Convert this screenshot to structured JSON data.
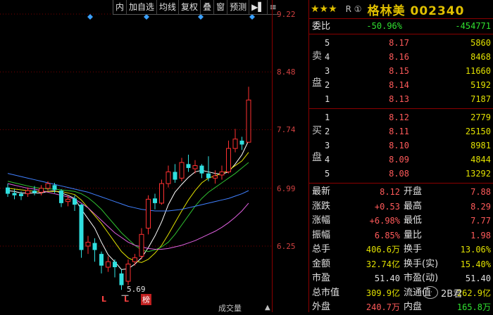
{
  "toolbar": {
    "items": [
      "内",
      "加自选",
      "均线",
      "复权",
      "叠",
      "窗",
      "预测"
    ],
    "expand_icon": "expand-icon",
    "menu_icon": "menu-icon"
  },
  "price_axis": [
    "9.22",
    "8.48",
    "7.74",
    "6.99",
    "6.25"
  ],
  "low_marker": {
    "label": "5.69",
    "value": 5.69
  },
  "bottom_badges": [
    "L",
    "L",
    "榜"
  ],
  "bottom_text": "成交量",
  "chart_data": {
    "type": "candlestick",
    "title": "",
    "ylim": [
      5.6,
      9.3
    ],
    "yticks": [
      9.22,
      8.48,
      7.74,
      6.99,
      6.25
    ],
    "candles": [
      {
        "o": 7.0,
        "c": 6.92,
        "h": 7.05,
        "l": 6.88
      },
      {
        "o": 6.93,
        "c": 6.9,
        "h": 6.98,
        "l": 6.85
      },
      {
        "o": 6.92,
        "c": 6.89,
        "h": 6.95,
        "l": 6.84
      },
      {
        "o": 6.92,
        "c": 6.96,
        "h": 7.0,
        "l": 6.88
      },
      {
        "o": 6.96,
        "c": 6.93,
        "h": 7.02,
        "l": 6.9
      },
      {
        "o": 6.94,
        "c": 6.99,
        "h": 7.03,
        "l": 6.9
      },
      {
        "o": 6.99,
        "c": 7.05,
        "h": 7.08,
        "l": 6.96
      },
      {
        "o": 7.03,
        "c": 6.97,
        "h": 7.06,
        "l": 6.93
      },
      {
        "o": 6.96,
        "c": 6.8,
        "h": 6.98,
        "l": 6.75
      },
      {
        "o": 6.82,
        "c": 6.85,
        "h": 6.9,
        "l": 6.76
      },
      {
        "o": 6.86,
        "c": 6.78,
        "h": 6.9,
        "l": 6.7
      },
      {
        "o": 6.78,
        "c": 6.2,
        "h": 6.79,
        "l": 6.1
      },
      {
        "o": 6.25,
        "c": 6.3,
        "h": 6.38,
        "l": 6.15
      },
      {
        "o": 6.29,
        "c": 6.2,
        "h": 6.35,
        "l": 6.05
      },
      {
        "o": 6.15,
        "c": 6.0,
        "h": 6.18,
        "l": 5.9
      },
      {
        "o": 5.98,
        "c": 6.05,
        "h": 6.12,
        "l": 5.92
      },
      {
        "o": 6.05,
        "c": 5.98,
        "h": 6.08,
        "l": 5.85
      },
      {
        "o": 5.9,
        "c": 5.75,
        "h": 5.95,
        "l": 5.69
      },
      {
        "o": 5.8,
        "c": 6.02,
        "h": 6.08,
        "l": 5.75
      },
      {
        "o": 6.05,
        "c": 6.1,
        "h": 6.15,
        "l": 6.0
      },
      {
        "o": 6.12,
        "c": 6.4,
        "h": 6.48,
        "l": 6.08
      },
      {
        "o": 6.48,
        "c": 6.85,
        "h": 6.9,
        "l": 6.4
      },
      {
        "o": 6.86,
        "c": 6.8,
        "h": 6.92,
        "l": 6.72
      },
      {
        "o": 6.8,
        "c": 7.05,
        "h": 7.1,
        "l": 6.78
      },
      {
        "o": 7.05,
        "c": 7.2,
        "h": 7.28,
        "l": 7.0
      },
      {
        "o": 7.2,
        "c": 7.1,
        "h": 7.3,
        "l": 7.06
      },
      {
        "o": 7.12,
        "c": 7.32,
        "h": 7.38,
        "l": 7.08
      },
      {
        "o": 7.3,
        "c": 7.25,
        "h": 7.42,
        "l": 7.2
      },
      {
        "o": 7.24,
        "c": 7.28,
        "h": 7.35,
        "l": 7.18
      },
      {
        "o": 7.28,
        "c": 7.18,
        "h": 7.3,
        "l": 7.12
      },
      {
        "o": 7.18,
        "c": 7.12,
        "h": 7.4,
        "l": 7.08
      },
      {
        "o": 7.12,
        "c": 7.15,
        "h": 7.22,
        "l": 7.05
      },
      {
        "o": 7.16,
        "c": 7.2,
        "h": 7.28,
        "l": 7.1
      },
      {
        "o": 7.2,
        "c": 7.5,
        "h": 7.6,
        "l": 7.18
      },
      {
        "o": 7.5,
        "c": 7.62,
        "h": 7.75,
        "l": 7.45
      },
      {
        "o": 7.6,
        "c": 7.55,
        "h": 7.65,
        "l": 7.48
      },
      {
        "o": 7.58,
        "c": 8.12,
        "h": 8.29,
        "l": 7.77
      }
    ],
    "ma_lines": [
      {
        "color": "#ffffff",
        "values": [
          6.96,
          6.95,
          6.93,
          6.93,
          6.93,
          6.93,
          6.95,
          6.96,
          6.93,
          6.9,
          6.86,
          6.72,
          6.6,
          6.48,
          6.3,
          6.14,
          6.05,
          5.95,
          5.96,
          6.02,
          6.1,
          6.23,
          6.38,
          6.56,
          6.78,
          6.94,
          7.04,
          7.13,
          7.2,
          7.22,
          7.2,
          7.18,
          7.17,
          7.2,
          7.3,
          7.42,
          7.6
        ]
      },
      {
        "color": "#e0e000",
        "values": [
          6.99,
          6.98,
          6.97,
          6.96,
          6.95,
          6.95,
          6.95,
          6.95,
          6.95,
          6.93,
          6.91,
          6.84,
          6.74,
          6.64,
          6.54,
          6.42,
          6.3,
          6.18,
          6.1,
          6.06,
          6.04,
          6.08,
          6.16,
          6.26,
          6.4,
          6.55,
          6.7,
          6.84,
          6.96,
          7.06,
          7.12,
          7.15,
          7.18,
          7.22,
          7.28,
          7.34,
          7.45
        ]
      },
      {
        "color": "#30c030",
        "values": [
          7.08,
          7.06,
          7.04,
          7.02,
          7.0,
          6.99,
          6.98,
          6.98,
          6.97,
          6.96,
          6.95,
          6.92,
          6.87,
          6.8,
          6.72,
          6.62,
          6.52,
          6.42,
          6.34,
          6.26,
          6.2,
          6.18,
          6.2,
          6.24,
          6.3,
          6.4,
          6.52,
          6.64,
          6.76,
          6.86,
          6.94,
          7.0,
          7.06,
          7.12,
          7.18,
          7.25,
          7.32
        ]
      },
      {
        "color": "#e060e0",
        "values": [
          7.05,
          7.03,
          7.01,
          6.99,
          6.98,
          6.96,
          6.94,
          6.92,
          6.9,
          6.88,
          6.85,
          6.8,
          6.74,
          6.66,
          6.58,
          6.5,
          6.42,
          6.36,
          6.3,
          6.26,
          6.24,
          6.22,
          6.21,
          6.21,
          6.22,
          6.24,
          6.26,
          6.29,
          6.32,
          6.36,
          6.4,
          6.44,
          6.49,
          6.55,
          6.62,
          6.7,
          6.8
        ]
      },
      {
        "color": "#4080ff",
        "values": [
          7.18,
          7.16,
          7.14,
          7.12,
          7.1,
          7.08,
          7.06,
          7.04,
          7.02,
          7.0,
          6.98,
          6.96,
          6.94,
          6.91,
          6.88,
          6.85,
          6.82,
          6.79,
          6.76,
          6.74,
          6.72,
          6.71,
          6.7,
          6.7,
          6.7,
          6.71,
          6.72,
          6.74,
          6.76,
          6.78,
          6.8,
          6.82,
          6.84,
          6.86,
          6.89,
          6.92,
          6.96
        ]
      }
    ]
  },
  "stock": {
    "stars": "★★★",
    "badge": "R ①",
    "name_code": "格林美 002340"
  },
  "weibi": {
    "label": "委比",
    "pct": "-50.96%",
    "diff": "-454771"
  },
  "sell": {
    "side_label": [
      "卖",
      "盘"
    ],
    "levels": [
      {
        "lvl": "5",
        "price": "8.17",
        "vol": "5860"
      },
      {
        "lvl": "4",
        "price": "8.16",
        "vol": "8468"
      },
      {
        "lvl": "3",
        "price": "8.15",
        "vol": "11660"
      },
      {
        "lvl": "2",
        "price": "8.14",
        "vol": "5192"
      },
      {
        "lvl": "1",
        "price": "8.13",
        "vol": "7187"
      }
    ]
  },
  "buy": {
    "side_label": [
      "买",
      "盘"
    ],
    "levels": [
      {
        "lvl": "1",
        "price": "8.12",
        "vol": "2779"
      },
      {
        "lvl": "2",
        "price": "8.11",
        "vol": "25150"
      },
      {
        "lvl": "3",
        "price": "8.10",
        "vol": "8981"
      },
      {
        "lvl": "4",
        "price": "8.09",
        "vol": "4844"
      },
      {
        "lvl": "5",
        "price": "8.08",
        "vol": "13292"
      }
    ]
  },
  "stats": [
    {
      "k1": "最新",
      "v1": "8.12",
      "c1": "red",
      "k2": "开盘",
      "v2": "7.88",
      "c2": "red"
    },
    {
      "k1": "涨跌",
      "v1": "+0.53",
      "c1": "red",
      "k2": "最高",
      "v2": "8.29",
      "c2": "red"
    },
    {
      "k1": "涨幅",
      "v1": "+6.98%",
      "c1": "red",
      "k2": "最低",
      "v2": "7.77",
      "c2": "red"
    },
    {
      "k1": "振幅",
      "v1": "6.85%",
      "c1": "red",
      "k2": "量比",
      "v2": "1.98",
      "c2": "red"
    },
    {
      "k1": "总手",
      "v1": "406.6万",
      "c1": "yellow",
      "k2": "换手",
      "v2": "13.06%",
      "c2": "yellow"
    },
    {
      "k1": "金额",
      "v1": "32.74亿",
      "c1": "yellow",
      "k2": "换手(实)",
      "v2": "15.40%",
      "c2": "yellow"
    },
    {
      "k1": "市盈",
      "v1": "51.40",
      "c1": "white",
      "k2": "市盈(动)",
      "v2": "51.40",
      "c2": "white"
    },
    {
      "k1": "总市值",
      "v1": "309.9亿",
      "c1": "yellow",
      "k2": "流通值",
      "v2": "262.9亿",
      "c2": "yellow"
    },
    {
      "k1": "外盘",
      "v1": "240.7万",
      "c1": "red",
      "k2": "内盘",
      "v2": "165.8万",
      "c2": "green"
    }
  ],
  "watermark": "2B君"
}
